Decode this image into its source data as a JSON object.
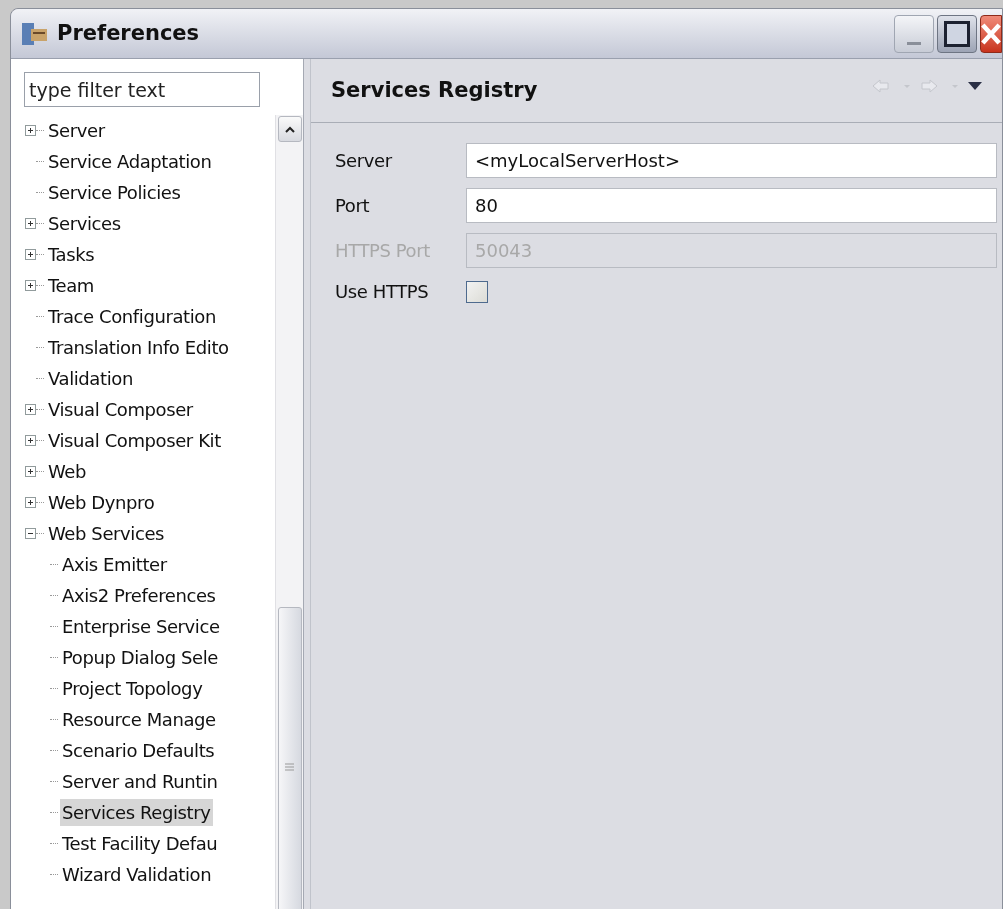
{
  "window": {
    "title": "Preferences"
  },
  "filter": {
    "placeholder": "type filter text"
  },
  "tree": [
    {
      "label": "Server",
      "kind": "node",
      "expanded": false,
      "selected": false
    },
    {
      "label": "Service Adaptation",
      "kind": "leaf",
      "selected": false
    },
    {
      "label": "Service Policies",
      "kind": "leaf",
      "selected": false
    },
    {
      "label": "Services",
      "kind": "node",
      "expanded": false,
      "selected": false
    },
    {
      "label": "Tasks",
      "kind": "node",
      "expanded": false,
      "selected": false
    },
    {
      "label": "Team",
      "kind": "node",
      "expanded": false,
      "selected": false
    },
    {
      "label": "Trace Configuration",
      "kind": "leaf",
      "selected": false
    },
    {
      "label": "Translation Info Edito",
      "kind": "leaf",
      "selected": false
    },
    {
      "label": "Validation",
      "kind": "leaf",
      "selected": false
    },
    {
      "label": "Visual Composer",
      "kind": "node",
      "expanded": false,
      "selected": false
    },
    {
      "label": "Visual Composer Kit",
      "kind": "node",
      "expanded": false,
      "selected": false
    },
    {
      "label": "Web",
      "kind": "node",
      "expanded": false,
      "selected": false
    },
    {
      "label": "Web Dynpro",
      "kind": "node",
      "expanded": false,
      "selected": false
    },
    {
      "label": "Web Services",
      "kind": "node",
      "expanded": true,
      "selected": false,
      "children": [
        {
          "label": "Axis Emitter",
          "selected": false
        },
        {
          "label": "Axis2 Preferences",
          "selected": false
        },
        {
          "label": "Enterprise Service",
          "selected": false
        },
        {
          "label": "Popup Dialog Sele",
          "selected": false
        },
        {
          "label": "Project Topology",
          "selected": false
        },
        {
          "label": "Resource Manage",
          "selected": false
        },
        {
          "label": "Scenario Defaults",
          "selected": false
        },
        {
          "label": "Server and Runtin",
          "selected": false
        },
        {
          "label": "Services Registry",
          "selected": true
        },
        {
          "label": "Test Facility Defau",
          "selected": false
        },
        {
          "label": "Wizard Validation",
          "selected": false
        }
      ]
    }
  ],
  "page": {
    "title": "Services Registry",
    "fields": [
      {
        "kind": "text",
        "label": "Server",
        "value": "<myLocalServerHost>",
        "disabled": false
      },
      {
        "kind": "text",
        "label": "Port",
        "value": "80",
        "disabled": false
      },
      {
        "kind": "text",
        "label": "HTTPS Port",
        "value": "50043",
        "disabled": true
      },
      {
        "kind": "checkbox",
        "label": "Use HTTPS",
        "checked": false
      }
    ]
  }
}
